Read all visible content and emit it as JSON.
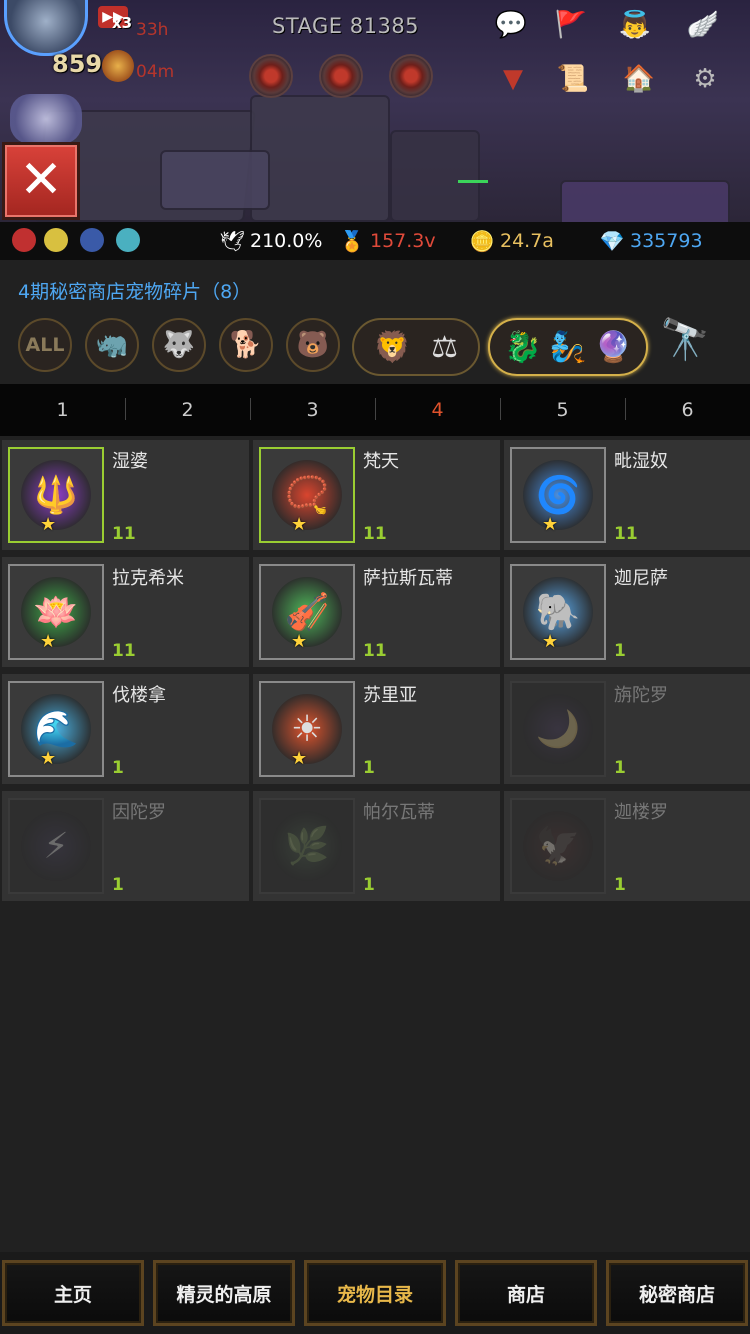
{
  "hud": {
    "level": "859",
    "boost_multiplier": "x3",
    "boost_time_1": "33h",
    "boost_time_2": "04m",
    "stage": "STAGE 81385",
    "close_icon": "close-icon",
    "icons": [
      "chat-icon",
      "guild-flag-icon",
      "angel-icon",
      "wing-helmet-icon",
      "down-arrow-icon",
      "map-scroll-icon",
      "house-alert-icon",
      "gear-icon"
    ]
  },
  "resources": {
    "wing_percent": "210.0%",
    "medal_value": "157.3v",
    "coin_value": "24.7a",
    "gem_value": "335793"
  },
  "panel": {
    "title": "4期秘密商店宠物碎片（8）",
    "filter_all": "ALL"
  },
  "tabs": [
    "1",
    "2",
    "3",
    "4",
    "5",
    "6"
  ],
  "active_tab": "4",
  "pets": [
    {
      "name": "湿婆",
      "count": "11",
      "owned": true,
      "color": "#8e3fc9",
      "icon": "🔱"
    },
    {
      "name": "梵天",
      "count": "11",
      "owned": true,
      "color": "#d9452e",
      "icon": "📿"
    },
    {
      "name": "毗湿奴",
      "count": "11",
      "owned": false,
      "color": "#4a8fe0",
      "icon": "🌀"
    },
    {
      "name": "拉克希米",
      "count": "11",
      "owned": false,
      "color": "#3fae4a",
      "icon": "🪷"
    },
    {
      "name": "萨拉斯瓦蒂",
      "count": "11",
      "owned": false,
      "color": "#4fb85a",
      "icon": "🎻"
    },
    {
      "name": "迦尼萨",
      "count": "1",
      "owned": false,
      "color": "#5aa6e6",
      "icon": "🐘"
    },
    {
      "name": "伐楼拿",
      "count": "1",
      "owned": false,
      "color": "#4ab0e0",
      "icon": "🌊"
    },
    {
      "name": "苏里亚",
      "count": "1",
      "owned": false,
      "color": "#e0552e",
      "icon": "☀"
    },
    {
      "name": "旃陀罗",
      "count": "1",
      "locked": true,
      "color": "#5a3a8a",
      "icon": "🌙"
    },
    {
      "name": "因陀罗",
      "count": "1",
      "locked": true,
      "color": "#4a3a7a",
      "icon": "⚡"
    },
    {
      "name": "帕尔瓦蒂",
      "count": "1",
      "locked": true,
      "color": "#3a6a3a",
      "icon": "🌿"
    },
    {
      "name": "迦楼罗",
      "count": "1",
      "locked": true,
      "color": "#7a2a2a",
      "icon": "🦅"
    }
  ],
  "bottom_nav": [
    "主页",
    "精灵的高原",
    "宠物目录",
    "商店",
    "秘密商店"
  ],
  "active_nav": "宠物目录"
}
